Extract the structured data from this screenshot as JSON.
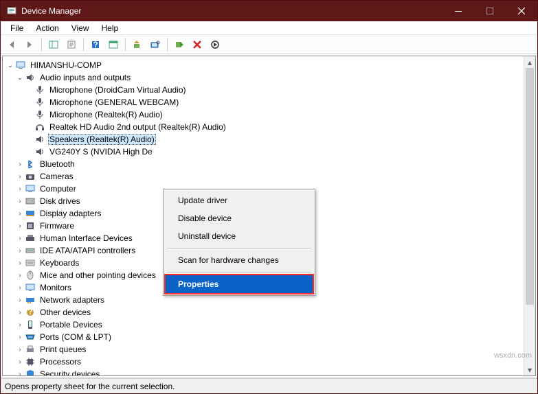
{
  "title": "Device Manager",
  "menubar": [
    "File",
    "Action",
    "View",
    "Help"
  ],
  "root": "HIMANSHU-COMP",
  "audio_group": "Audio inputs and outputs",
  "audio_items": [
    "Microphone (DroidCam Virtual Audio)",
    "Microphone (GENERAL WEBCAM)",
    "Microphone (Realtek(R) Audio)",
    "Realtek HD Audio 2nd output (Realtek(R) Audio)",
    "Speakers (Realtek(R) Audio)",
    "VG240Y S (NVIDIA High De"
  ],
  "categories": [
    "Bluetooth",
    "Cameras",
    "Computer",
    "Disk drives",
    "Display adapters",
    "Firmware",
    "Human Interface Devices",
    "IDE ATA/ATAPI controllers",
    "Keyboards",
    "Mice and other pointing devices",
    "Monitors",
    "Network adapters",
    "Other devices",
    "Portable Devices",
    "Ports (COM & LPT)",
    "Print queues",
    "Processors",
    "Security devices"
  ],
  "ctx": {
    "update": "Update driver",
    "disable": "Disable device",
    "uninstall": "Uninstall device",
    "scan": "Scan for hardware changes",
    "properties": "Properties"
  },
  "status": "Opens property sheet for the current selection.",
  "watermark": "wsxdn.com"
}
